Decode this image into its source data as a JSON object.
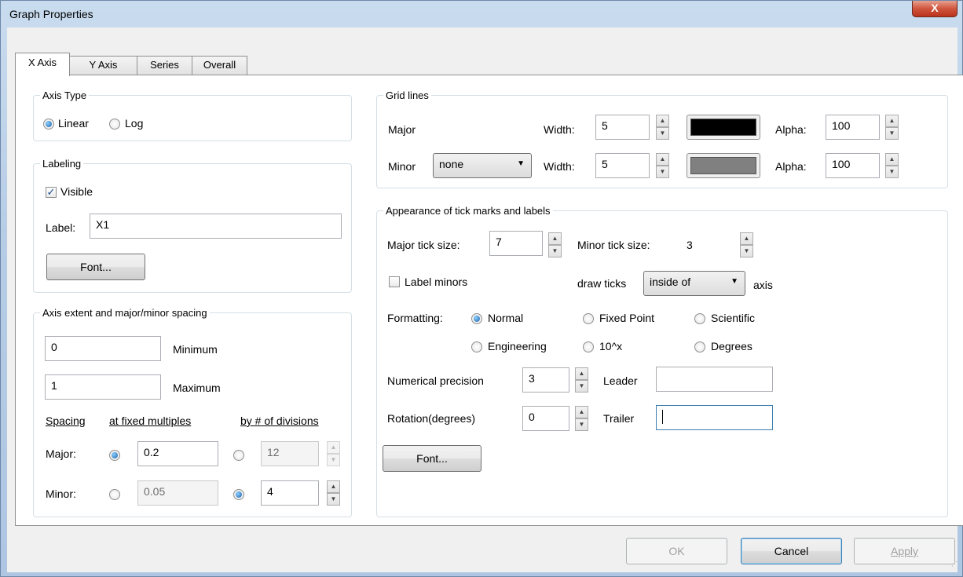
{
  "window": {
    "title": "Graph Properties",
    "close_label": "X"
  },
  "tabs": [
    "X Axis",
    "Y Axis",
    "Series",
    "Overall"
  ],
  "axis_type": {
    "legend": "Axis Type",
    "linear_label": "Linear",
    "log_label": "Log",
    "selected": "Linear"
  },
  "labeling": {
    "legend": "Labeling",
    "visible_label": "Visible",
    "visible_checked": true,
    "label_caption": "Label:",
    "label_value": "X1",
    "font_button": "Font..."
  },
  "extent": {
    "legend": "Axis extent and major/minor spacing",
    "minimum_value": "0",
    "minimum_label": "Minimum",
    "maximum_value": "1",
    "maximum_label": "Maximum",
    "spacing_label": "Spacing",
    "fixed_label": "at fixed  multiples",
    "divisions_label": "by # of divisions",
    "major_label": "Major:",
    "major_fixed": "0.2",
    "major_divisions": "12",
    "minor_label": "Minor:",
    "minor_fixed": "0.05",
    "minor_divisions": "4"
  },
  "grid": {
    "legend": "Grid lines",
    "major_label": "Major",
    "major_width_label": "Width:",
    "major_width": "5",
    "major_color": "#000000",
    "major_alpha_label": "Alpha:",
    "major_alpha": "100",
    "minor_label": "Minor",
    "minor_style": "none",
    "minor_width_label": "Width:",
    "minor_width": "5",
    "minor_color": "#808080",
    "minor_alpha_label": "Alpha:",
    "minor_alpha": "100"
  },
  "ticks": {
    "legend": "Appearance of tick marks and labels",
    "major_size_label": "Major tick size:",
    "major_size": "7",
    "minor_size_label": "Minor tick size:",
    "minor_size": "3",
    "label_minors": "Label minors",
    "label_minors_checked": false,
    "draw_ticks_label": "draw ticks",
    "draw_ticks_value": "inside of",
    "axis_label": "axis",
    "formatting_label": "Formatting:",
    "formats": [
      "Normal",
      "Fixed Point",
      "Scientific",
      "Engineering",
      "10^x",
      "Degrees"
    ],
    "format_selected": "Normal",
    "precision_label": "Numerical precision",
    "precision": "3",
    "leader_label": "Leader",
    "leader_value": "",
    "rotation_label": "Rotation(degrees)",
    "rotation": "0",
    "trailer_label": "Trailer",
    "trailer_value": "",
    "font_button": "Font..."
  },
  "footer": {
    "ok": "OK",
    "cancel": "Cancel",
    "apply": "Apply"
  }
}
